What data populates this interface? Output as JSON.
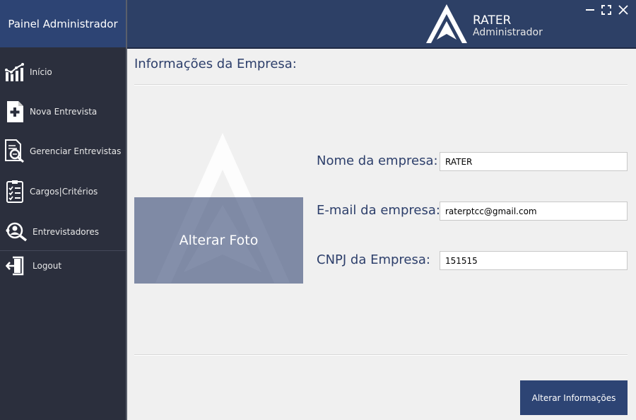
{
  "sidebar": {
    "title": "Painel Administrador",
    "items": [
      {
        "label": "Início",
        "icon": "chart-icon"
      },
      {
        "label": "Nova Entrevista",
        "icon": "add-document-icon"
      },
      {
        "label": "Gerenciar Entrevistas",
        "icon": "search-document-icon"
      },
      {
        "label": "Cargos|Critérios",
        "icon": "checklist-icon"
      },
      {
        "label": "Entrevistadores",
        "icon": "users-search-icon"
      },
      {
        "label": "Logout",
        "icon": "logout-icon"
      }
    ]
  },
  "header": {
    "brand_title": "RATER",
    "brand_subtitle": "Administrador",
    "window_controls": [
      "minimize-icon",
      "maximize-icon",
      "close-icon"
    ]
  },
  "main": {
    "section_title": "Informações da Empresa:",
    "photo_button": "Alterar Foto",
    "fields": [
      {
        "label": "Nome da empresa:",
        "value": "RATER"
      },
      {
        "label": "E-mail da empresa:",
        "value": "raterptcc@gmail.com"
      },
      {
        "label": "CNPJ da Empresa:",
        "value": "151515"
      }
    ],
    "submit_label": "Alterar Informações"
  },
  "colors": {
    "sidebar_bg": "#2b2f3d",
    "header_bg": "#2d4066",
    "accent": "#2d4474",
    "text_title": "#2d3f6b",
    "content_bg": "#f0f0f0"
  }
}
